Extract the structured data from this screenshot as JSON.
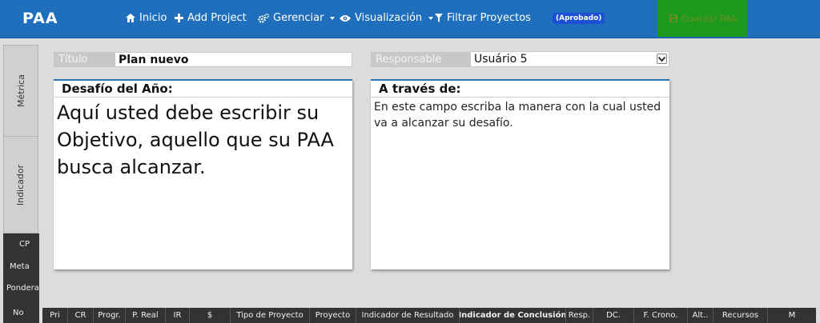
{
  "navbar": {
    "brand": "PAA",
    "items": [
      {
        "label": "Inicio"
      },
      {
        "label": "Add Project"
      },
      {
        "label": "Gerenciar"
      },
      {
        "label": "Visualización"
      },
      {
        "label": "Filtrar Proyectos"
      }
    ],
    "status_badge": "(Aprobado)",
    "save_label": "Guardar PAA"
  },
  "sidebar": {
    "tabs": [
      {
        "label": "Métrica"
      },
      {
        "label": "Indicador"
      }
    ],
    "metrics": [
      "CP",
      "Meta",
      "Ponderación",
      "No"
    ]
  },
  "form": {
    "title_label": "Título",
    "title_value": "Plan nuevo",
    "responsible_label": "Responsable",
    "responsible_value": "Usuário 5"
  },
  "panels": {
    "challenge": {
      "header": "Desafío del Año:",
      "body": "Aquí usted debe escribir su Objetivo, aquello que su PAA busca alcanzar."
    },
    "through": {
      "header": "A través de:",
      "body": "En este campo escriba la manera con la cual usted va a alcanzar su desafío."
    }
  },
  "columns": [
    "Pri",
    "CR",
    "Progr.",
    "P. Real",
    "IR",
    "$",
    "Tipo de Proyecto",
    "Proyecto",
    "Indicador de Resultado",
    "Indicador de Conclusión",
    "Resp.",
    "DC.",
    "F. Crono.",
    "Alt..",
    "Recursos",
    "M"
  ],
  "colors": {
    "navbar": "#1f6fbd",
    "save_button": "#1d9a1d",
    "badge": "#1b4fd6",
    "panel_accent": "#2a73b8",
    "dark_bar": "#333333"
  }
}
